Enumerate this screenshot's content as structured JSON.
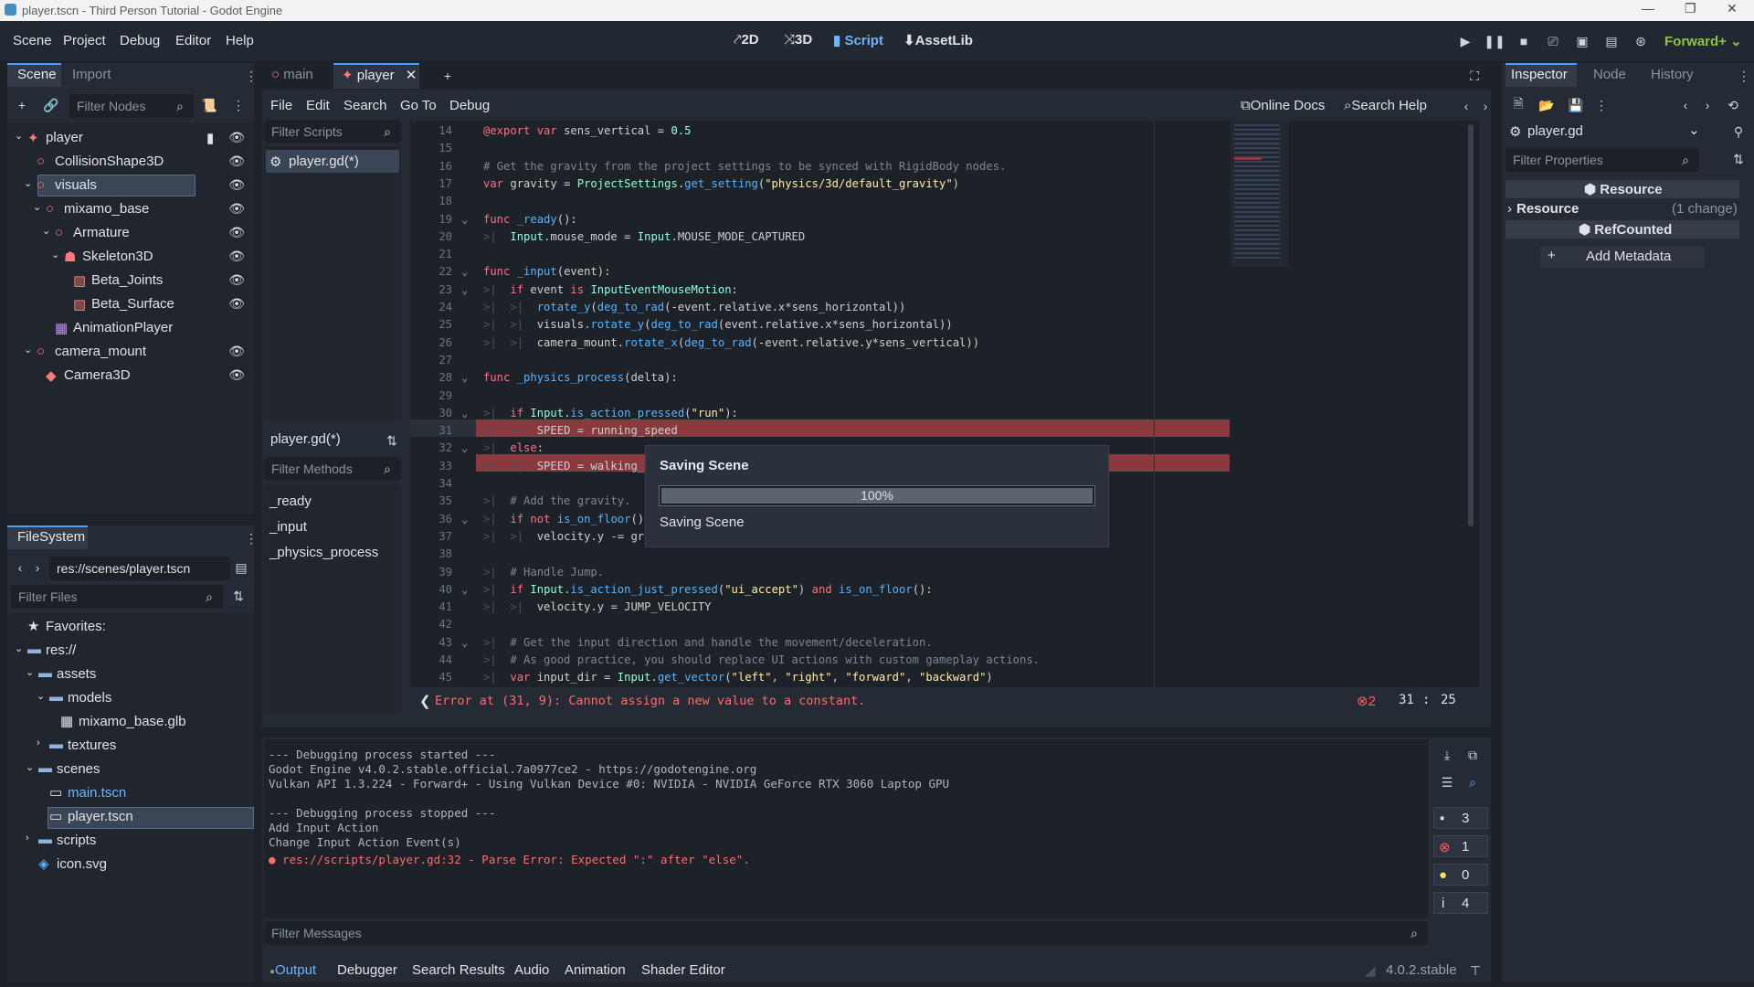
{
  "window": {
    "title": "player.tscn - Third Person Tutorial - Godot Engine"
  },
  "menu": [
    "Scene",
    "Project",
    "Debug",
    "Editor",
    "Help"
  ],
  "modes": {
    "m2d": "2D",
    "m3d": "3D",
    "script": "Script",
    "assetlib": "AssetLib"
  },
  "renderer": "Forward+",
  "scene_dock": {
    "tab_scene": "Scene",
    "tab_import": "Import",
    "filter": "Filter Nodes",
    "nodes": [
      {
        "label": "player",
        "depth": 0
      },
      {
        "label": "CollisionShape3D",
        "depth": 1
      },
      {
        "label": "visuals",
        "depth": 1
      },
      {
        "label": "mixamo_base",
        "depth": 2
      },
      {
        "label": "Armature",
        "depth": 3
      },
      {
        "label": "Skeleton3D",
        "depth": 4
      },
      {
        "label": "Beta_Joints",
        "depth": 5
      },
      {
        "label": "Beta_Surface",
        "depth": 5
      },
      {
        "label": "AnimationPlayer",
        "depth": 3
      },
      {
        "label": "camera_mount",
        "depth": 1
      },
      {
        "label": "Camera3D",
        "depth": 2
      }
    ]
  },
  "filesystem": {
    "tab": "FileSystem",
    "path": "res://scenes/player.tscn",
    "filter": "Filter Files",
    "items": [
      {
        "label": "Favorites:",
        "depth": 0
      },
      {
        "label": "res://",
        "depth": 0
      },
      {
        "label": "assets",
        "depth": 1
      },
      {
        "label": "models",
        "depth": 2
      },
      {
        "label": "mixamo_base.glb",
        "depth": 3
      },
      {
        "label": "textures",
        "depth": 2
      },
      {
        "label": "scenes",
        "depth": 1
      },
      {
        "label": "main.tscn",
        "depth": 2
      },
      {
        "label": "player.tscn",
        "depth": 2
      },
      {
        "label": "scripts",
        "depth": 1
      },
      {
        "label": "icon.svg",
        "depth": 1
      }
    ]
  },
  "editor_tabs": {
    "main": "main",
    "player": "player"
  },
  "script_menu": [
    "File",
    "Edit",
    "Search",
    "Go To",
    "Debug"
  ],
  "script_links": {
    "docs": "Online Docs",
    "help": "Search Help"
  },
  "script_list": {
    "filter": "Filter Scripts",
    "items": [
      "player.gd(*)"
    ],
    "current": "player.gd(*)",
    "filter_methods": "Filter Methods",
    "methods": [
      "_ready",
      "_input",
      "_physics_process"
    ]
  },
  "code": [
    {
      "n": "14",
      "t": "@export var sens_vertical = 0.5"
    },
    {
      "n": "15",
      "t": ""
    },
    {
      "n": "16",
      "t": "# Get the gravity from the project settings to be synced with RigidBody nodes."
    },
    {
      "n": "17",
      "t": "var gravity = ProjectSettings.get_setting(\"physics/3d/default_gravity\")"
    },
    {
      "n": "18",
      "t": ""
    },
    {
      "n": "19",
      "t": "func _ready():"
    },
    {
      "n": "20",
      "t": "    Input.mouse_mode = Input.MOUSE_MODE_CAPTURED"
    },
    {
      "n": "21",
      "t": ""
    },
    {
      "n": "22",
      "t": "func _input(event):"
    },
    {
      "n": "23",
      "t": "    if event is InputEventMouseMotion:"
    },
    {
      "n": "24",
      "t": "        rotate_y(deg_to_rad(-event.relative.x*sens_horizontal))"
    },
    {
      "n": "25",
      "t": "        visuals.rotate_y(deg_to_rad(event.relative.x*sens_horizontal))"
    },
    {
      "n": "26",
      "t": "        camera_mount.rotate_x(deg_to_rad(-event.relative.y*sens_vertical))"
    },
    {
      "n": "27",
      "t": ""
    },
    {
      "n": "28",
      "t": "func _physics_process(delta):"
    },
    {
      "n": "29",
      "t": ""
    },
    {
      "n": "30",
      "t": "    if Input.is_action_pressed(\"run\"):"
    },
    {
      "n": "31",
      "t": "        SPEED = running_speed"
    },
    {
      "n": "32",
      "t": "    else:"
    },
    {
      "n": "33",
      "t": "        SPEED = walking_s"
    },
    {
      "n": "34",
      "t": ""
    },
    {
      "n": "35",
      "t": "    # Add the gravity."
    },
    {
      "n": "36",
      "t": "    if not is_on_floor()"
    },
    {
      "n": "37",
      "t": "        velocity.y -= gra"
    },
    {
      "n": "38",
      "t": ""
    },
    {
      "n": "39",
      "t": "    # Handle Jump."
    },
    {
      "n": "40",
      "t": "    if Input.is_action_just_pressed(\"ui_accept\") and is_on_floor():"
    },
    {
      "n": "41",
      "t": "        velocity.y = JUMP_VELOCITY"
    },
    {
      "n": "42",
      "t": ""
    },
    {
      "n": "43",
      "t": "    # Get the input direction and handle the movement/deceleration."
    },
    {
      "n": "44",
      "t": "    # As good practice, you should replace UI actions with custom gameplay actions."
    },
    {
      "n": "45",
      "t": "    var input_dir = Input.get_vector(\"left\", \"right\", \"forward\", \"backward\")"
    }
  ],
  "error_bar": {
    "message": "Error at (31, 9): Cannot assign a new value to a constant.",
    "count": "2",
    "line": "31",
    "col": "25"
  },
  "dialog": {
    "title": "Saving Scene",
    "progress": "100%",
    "progress_value": 1.0,
    "status": "Saving Scene"
  },
  "output": {
    "lines": [
      "--- Debugging process started ---",
      "Godot Engine v4.0.2.stable.official.7a0977ce2 - https://godotengine.org",
      "Vulkan API 1.3.224 - Forward+ - Using Vulkan Device #0: NVIDIA - NVIDIA GeForce RTX 3060 Laptop GPU",
      "",
      "--- Debugging process stopped ---",
      "Add Input Action",
      "Change Input Action Event(s)"
    ],
    "error_line": "res://scripts/player.gd:32 - Parse Error: Expected \":\" after \"else\".",
    "filter": "Filter Messages",
    "counts": {
      "messages": "3",
      "errors": "1",
      "warnings": "0",
      "info": "4"
    }
  },
  "bottom_tabs": [
    "Output",
    "Debugger",
    "Search Results",
    "Audio",
    "Animation",
    "Shader Editor"
  ],
  "version": "4.0.2.stable",
  "inspector": {
    "tab_inspector": "Inspector",
    "tab_node": "Node",
    "tab_history": "History",
    "object": "player.gd",
    "filter": "Filter Properties",
    "section_resource": "Resource",
    "row_resource": "Resource",
    "row_change": "(1 change)",
    "section_refcounted": "RefCounted",
    "add_metadata": "Add Metadata"
  },
  "colors": {
    "accent": "#4b9eff",
    "error": "#ff5d5d",
    "highlight": "#8a3a3e",
    "warning": "#ffde66"
  }
}
